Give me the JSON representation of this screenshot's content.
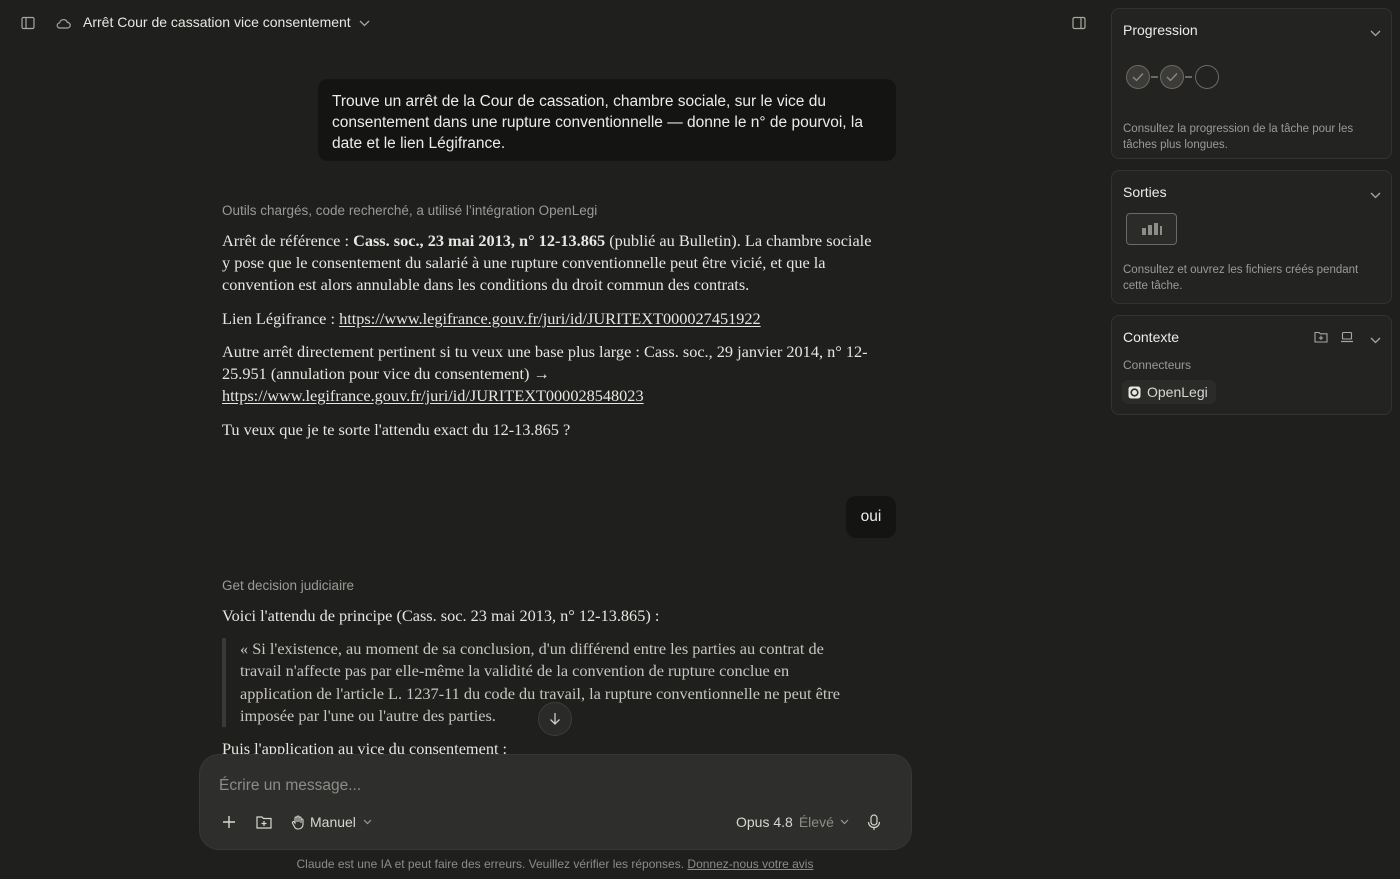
{
  "topbar": {
    "title": "Arrêt Cour de cassation vice consentement",
    "icons": [
      "sidebar-toggle-icon",
      "cloud-icon",
      "chevron-down-icon",
      "panel-toggle-icon"
    ]
  },
  "messages": {
    "user1": "Trouve un arrêt de la Cour de cassation, chambre sociale, sur le vice du consentement dans une rupture conventionnelle — donne le n° de pourvoi, la date et le lien Légifrance.",
    "tool1": "Outils chargés, code recherché, a utilisé l’intégration OpenLegi",
    "p1_prefix": "Arrêt de référence : ",
    "p1_bold": "Cass. soc., 23 mai 2013, n° 12-13.865",
    "p1_rest": " (publié au Bulletin). La chambre sociale y pose que le consentement du salarié à une rupture conventionnelle peut être vicié, et que la convention est alors annulable dans les conditions du droit commun des contrats.",
    "p2_prefix": "Lien Légifrance : ",
    "p2_link": "https://www.legifrance.gouv.fr/juri/id/JURITEXT000027451922",
    "p3_text": "Autre arrêt directement pertinent si tu veux une base plus large : Cass. soc., 29 janvier 2014, n° 12-25.951 (annulation pour vice du consentement) →",
    "p3_link": "https://www.legifrance.gouv.fr/juri/id/JURITEXT000028548023",
    "p4": "Tu veux que je te sorte l'attendu exact du 12-13.865 ?",
    "user2": "oui",
    "tool2": "Get decision judiciaire",
    "p5": "Voici l'attendu de principe (Cass. soc. 23 mai 2013, n° 12-13.865) :",
    "quote": "« Si l'existence, au moment de sa conclusion, d'un différend entre les parties au contrat de travail n'affecte pas par elle-même la validité de la convention de rupture conclue en application de l'article L. 1237-11 du code du travail, la rupture conventionnelle ne peut être imposée par l'une ou l'autre des parties.",
    "p6": "Puis l'application au vice du consentement :"
  },
  "composer": {
    "placeholder": "Écrire un message...",
    "mode_label": "Manuel",
    "model_label": "Opus 4.8",
    "effort_label": "Élevé"
  },
  "footer": {
    "note": "Claude est une IA et peut faire des erreurs. Veuillez vérifier les réponses.",
    "feedback_link": "Donnez-nous votre avis"
  },
  "panel": {
    "progress": {
      "title": "Progression",
      "steps_done": 2,
      "steps_total": 3,
      "desc": "Consultez la progression de la tâche pour les tâches plus longues."
    },
    "outputs": {
      "title": "Sorties",
      "desc": "Consultez et ouvrez les fichiers créés pendant cette tâche."
    },
    "context": {
      "title": "Contexte",
      "subtitle": "Connecteurs",
      "connector": "OpenLegi"
    }
  }
}
